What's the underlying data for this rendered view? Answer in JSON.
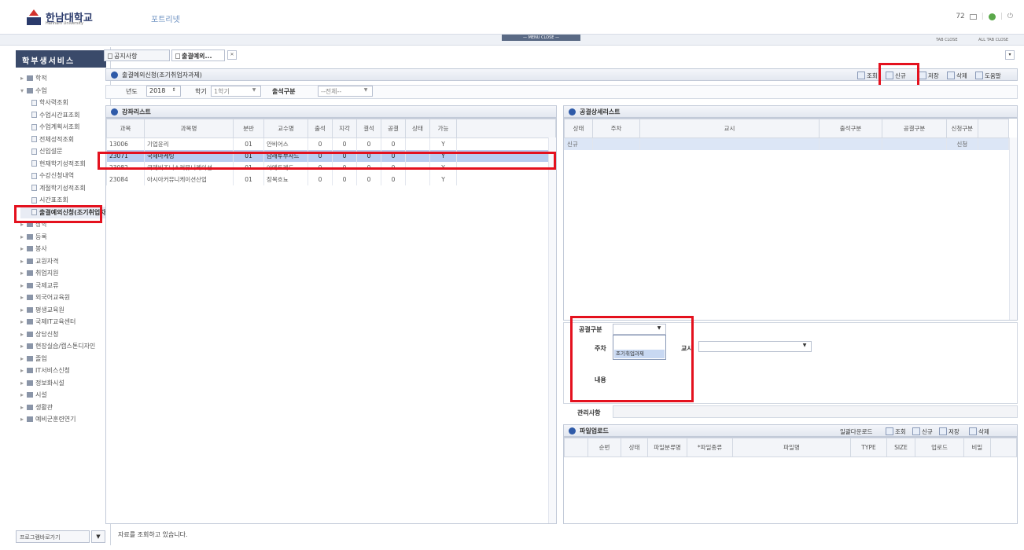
{
  "header": {
    "logo_text": "한남대학교",
    "logo_sub": "Hannam University",
    "portal_link": "포트리넷",
    "user_text": "72",
    "menu_close": "— MENU CLOSE —",
    "tab_close": "TAB CLOSE",
    "all_tab_close": "ALL TAB CLOSE"
  },
  "sidebar": {
    "title": "학부생서비스",
    "items": [
      {
        "label": "학적",
        "type": "folder"
      },
      {
        "label": "수업",
        "type": "folder-open"
      },
      {
        "label": "학사력조회",
        "type": "doc"
      },
      {
        "label": "수업시간표조회",
        "type": "doc"
      },
      {
        "label": "수업계획서조회",
        "type": "doc"
      },
      {
        "label": "전체성적조회",
        "type": "doc"
      },
      {
        "label": "신입설문",
        "type": "doc"
      },
      {
        "label": "현재학기성적조회",
        "type": "doc"
      },
      {
        "label": "수강신청내역",
        "type": "doc"
      },
      {
        "label": "계절학기성적조회",
        "type": "doc"
      },
      {
        "label": "시간표조회",
        "type": "doc"
      },
      {
        "label": "출결예외신청(조기취업자과제)",
        "type": "doc"
      },
      {
        "label": "장학",
        "type": "folder"
      },
      {
        "label": "등록",
        "type": "folder"
      },
      {
        "label": "봉사",
        "type": "folder"
      },
      {
        "label": "교원자격",
        "type": "folder"
      },
      {
        "label": "취업지원",
        "type": "folder"
      },
      {
        "label": "국제교류",
        "type": "folder"
      },
      {
        "label": "외국어교육원",
        "type": "folder"
      },
      {
        "label": "평생교육원",
        "type": "folder"
      },
      {
        "label": "국제IT교육센터",
        "type": "folder"
      },
      {
        "label": "상담신청",
        "type": "folder"
      },
      {
        "label": "현장실습/캡스톤디자인",
        "type": "folder"
      },
      {
        "label": "졸업",
        "type": "folder"
      },
      {
        "label": "IT서비스신청",
        "type": "folder"
      },
      {
        "label": "정보화시설",
        "type": "folder"
      },
      {
        "label": "시설",
        "type": "folder"
      },
      {
        "label": "생활관",
        "type": "folder"
      },
      {
        "label": "예비군훈련연기",
        "type": "folder"
      }
    ],
    "program_shortcut": "프로그램바로가기"
  },
  "doc_tabs": [
    {
      "label": "공지사항"
    },
    {
      "label": "출결예외..."
    }
  ],
  "page": {
    "title": "출결예외신청(조기취업자과제)",
    "toolbar": {
      "search": "조회",
      "new": "신규",
      "save": "저장",
      "delete": "삭제",
      "help": "도움말"
    }
  },
  "filters": {
    "year_label": "년도",
    "year_value": "2018",
    "term_label": "학기",
    "term_value": "1학기",
    "attend_label": "출석구분",
    "attend_value": "--전체--"
  },
  "course_list": {
    "title": "강좌리스트",
    "headers": [
      "과목",
      "과목명",
      "분반",
      "교수명",
      "출석",
      "지각",
      "결석",
      "공결",
      "상태",
      "가능"
    ],
    "rows": [
      [
        "13006",
        "기업윤리",
        "01",
        "안비어스",
        "0",
        "0",
        "0",
        "0",
        "",
        "Y"
      ],
      [
        "23071",
        "국제마케팅",
        "01",
        "남래투부사드",
        "0",
        "0",
        "0",
        "0",
        "",
        "Y"
      ],
      [
        "23082",
        "국제비즈니스커뮤니케이션",
        "01",
        "아메트레드",
        "0",
        "0",
        "0",
        "0",
        "",
        "Y"
      ],
      [
        "23084",
        "아시아커뮤니케이션산업",
        "01",
        "장목흐뇨",
        "0",
        "0",
        "0",
        "0",
        "",
        "Y"
      ]
    ]
  },
  "detail_list": {
    "title": "공결상세리스트",
    "headers": [
      "상태",
      "주차",
      "교시",
      "출석구분",
      "공결구분",
      "신청구분"
    ],
    "rows": [
      [
        "신규",
        "",
        "",
        "",
        "",
        "신청"
      ]
    ]
  },
  "form": {
    "type_label": "공결구분",
    "type_option": "조기취업과제",
    "week_label": "주차",
    "period_label": "교시",
    "content_label": "내용",
    "admin_label": "관리사항"
  },
  "file_upload": {
    "title": "파일업로드",
    "toolbar": {
      "batch_download": "일괄다운로드",
      "search": "조회",
      "new": "신규",
      "save": "저장",
      "delete": "삭제"
    },
    "headers": [
      "",
      "순번",
      "상태",
      "파일분류명",
      "*파일종류",
      "파일명",
      "TYPE",
      "SIZE",
      "업로드",
      "비밀"
    ]
  },
  "status_bar": {
    "text": "자료를 조회하고 있습니다."
  }
}
